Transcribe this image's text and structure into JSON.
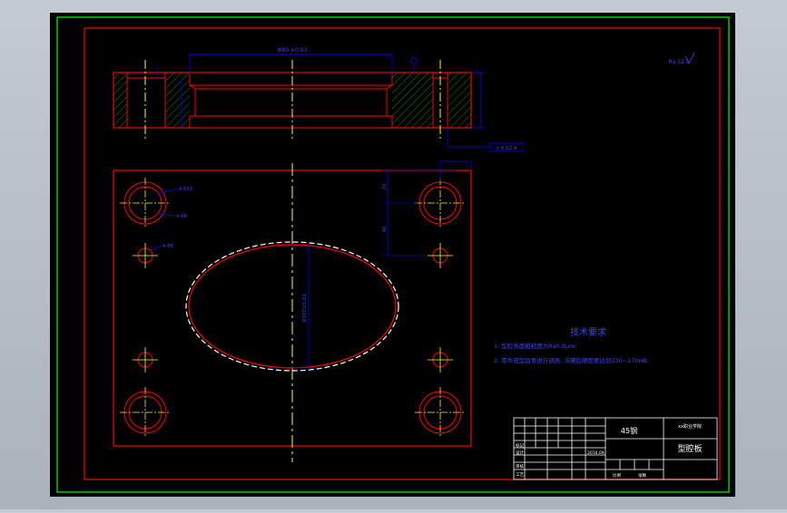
{
  "colors": {
    "viewport_bg": "#000000",
    "frame_outer": "#00ff00",
    "frame_inner": "#ff0000",
    "part_outline": "#ff0000",
    "center_line": "#ffff00",
    "dimension": "#0000ff",
    "hatch": "#00a000",
    "text_blue": "#4040ff",
    "title_block": "#ffffff"
  },
  "drawing": {
    "section_dimension_top": "Φ80 ±0.03",
    "roughness_note": "Ra 12.5",
    "tolerance_frame": "// 0.02 A",
    "hole_callout_upper": "4-Φ16",
    "hole_callout_lower": "4-Φ8",
    "pin_hole_callout": "4-Φ8",
    "right_dims": [
      "20",
      "46"
    ],
    "oval_dimension": "Φ100±0.02"
  },
  "technical": {
    "title": "技术要求",
    "req1": "1. 型腔表面粗糙度为Ra0.8μm;",
    "req2": "2. 零件成型后要进行调质, 淬硬后硬度要达到230~270HB;"
  },
  "title_block": {
    "material": "45钢",
    "school": "xx职业学院",
    "part_name": "型腔板",
    "scale_label": "比例",
    "sheet_label": "张数",
    "row_labels": [
      "标记",
      "设计",
      "审核",
      "工艺"
    ],
    "date_label": "2016.09"
  }
}
